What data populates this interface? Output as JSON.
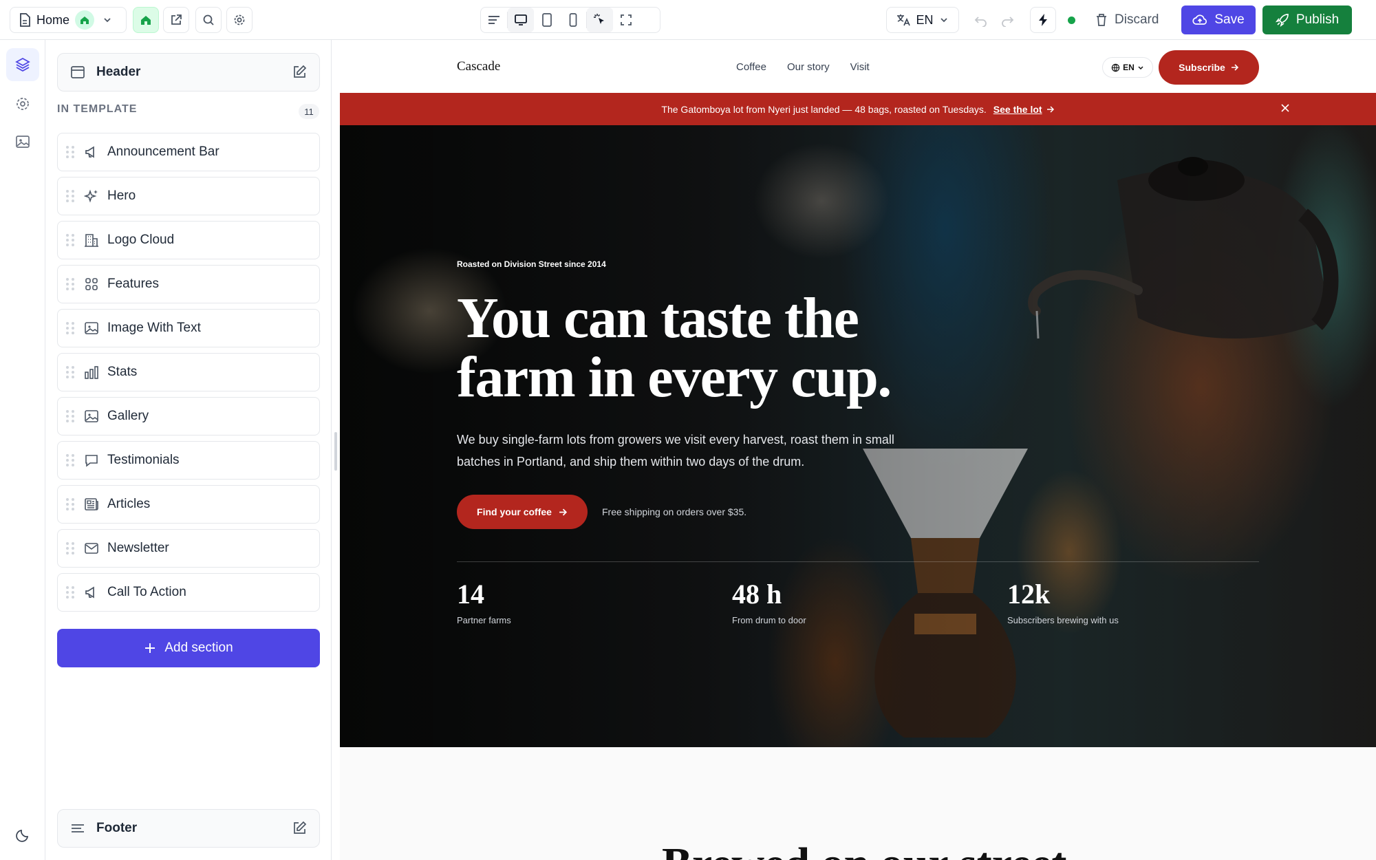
{
  "toolbar": {
    "page_name": "Home",
    "language": "EN",
    "discard_label": "Discard",
    "save_label": "Save",
    "publish_label": "Publish",
    "status_color": "#16a34a"
  },
  "panel": {
    "header_label": "Header",
    "template_label": "IN TEMPLATE",
    "template_count": "11",
    "sections": [
      {
        "label": "Announcement Bar",
        "icon": "megaphone-icon"
      },
      {
        "label": "Hero",
        "icon": "sparkles-icon"
      },
      {
        "label": "Logo Cloud",
        "icon": "building-icon"
      },
      {
        "label": "Features",
        "icon": "grid-icon"
      },
      {
        "label": "Image With Text",
        "icon": "image-icon"
      },
      {
        "label": "Stats",
        "icon": "bar-chart-icon"
      },
      {
        "label": "Gallery",
        "icon": "image-icon"
      },
      {
        "label": "Testimonials",
        "icon": "chat-bubble-icon"
      },
      {
        "label": "Articles",
        "icon": "newspaper-icon"
      },
      {
        "label": "Newsletter",
        "icon": "mail-icon"
      },
      {
        "label": "Call To Action",
        "icon": "megaphone-icon"
      }
    ],
    "add_section_label": "Add section",
    "footer_label": "Footer"
  },
  "site": {
    "logo": "Cascade",
    "nav": [
      "Coffee",
      "Our story",
      "Visit"
    ],
    "lang": "EN",
    "subscribe_label": "Subscribe",
    "brand_color": "#b3261e",
    "announcement": {
      "text": "The Gatomboya lot from Nyeri just landed — 48 bags, roasted on Tuesdays.",
      "link": "See the lot"
    },
    "hero": {
      "eyebrow": "Roasted on Division Street since 2014",
      "title_line1": "You can taste the",
      "title_line2": "farm in every cup.",
      "body": "We buy single-farm lots from growers we visit every harvest, roast them in small batches in Portland, and ship them within two days of the drum.",
      "cta_label": "Find your coffee",
      "note": "Free shipping on orders over $35.",
      "stats": [
        {
          "value": "14",
          "label": "Partner farms"
        },
        {
          "value": "48 h",
          "label": "From drum to door"
        },
        {
          "value": "12k",
          "label": "Subscribers brewing with us"
        }
      ]
    },
    "next_section_title": "Brewed on our street"
  },
  "accent_color": "#4f46e5",
  "publish_color": "#15803d"
}
